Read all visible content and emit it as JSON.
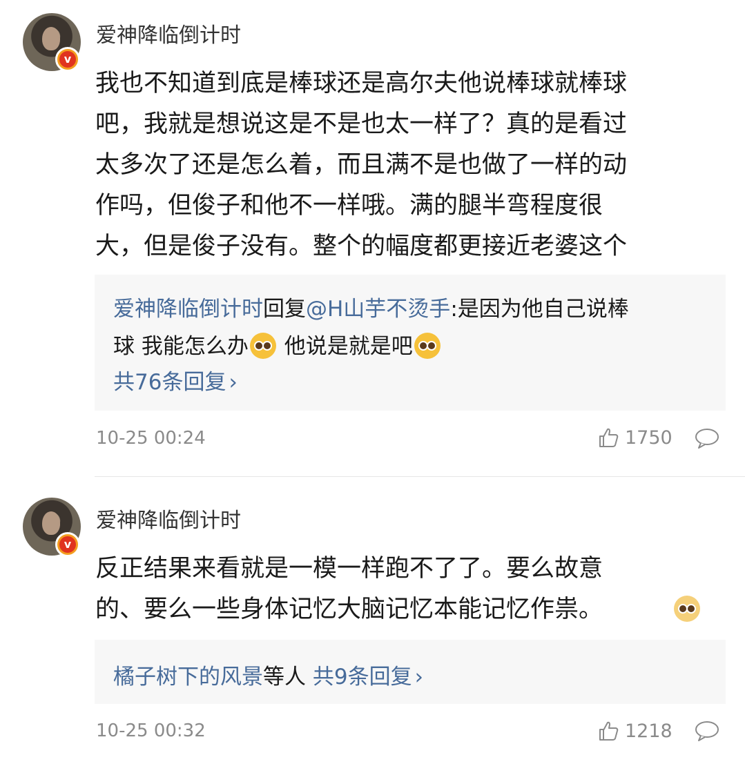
{
  "comments": [
    {
      "username": "爱神降临倒计时",
      "badge": "v",
      "body_lines": [
        "我也不知道到底是棒球还是高尔夫他说棒球就棒球",
        "吧，我就是想说这是不是也太一样了？真的是看过",
        "太多次了还是怎么着，而且满不是也做了一样的动",
        "作吗，但俊子和他不一样哦。满的腿半弯程度很",
        "大，但是俊子没有。整个的幅度都更接近老婆这个"
      ],
      "reply": {
        "author": "爱神降临倒计时",
        "reply_word": "回复",
        "mention": "@H山芋不烫手",
        "text_line1": ":是因为他自己说棒",
        "text_line2_a": "球 我能怎么办",
        "text_line2_b": " 他说是就是吧",
        "emoji": "pleading-face-emoji",
        "more": "共76条回复",
        "more_arrow": "›"
      },
      "timestamp": "10-25 00:24",
      "likes": "1750"
    },
    {
      "username": "爱神降临倒计时",
      "badge": "v",
      "body_lines": [
        "反正结果来看就是一模一样跑不了了。要么故意",
        "的、要么一些身体记忆大脑记忆本能记忆作祟。"
      ],
      "body_emoji": "shy-face-emoji",
      "reply": {
        "link_user": "橘子树下的风景",
        "others": "等人 ",
        "more": "共9条回复",
        "more_arrow": "›"
      },
      "timestamp": "10-25 00:32",
      "likes": "1218"
    }
  ],
  "colors": {
    "link": "#476b9a",
    "badge_orange": "#f49d20",
    "reply_bg": "#f7f7f7",
    "meta_gray": "#8a8a8a"
  }
}
